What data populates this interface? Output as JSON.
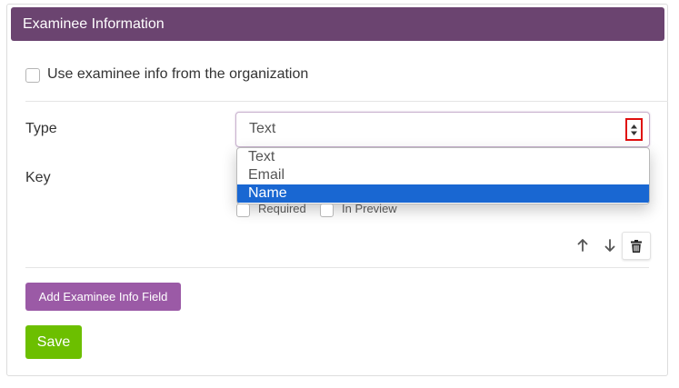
{
  "panel": {
    "title": "Examinee Information"
  },
  "use_org_info": {
    "label": "Use examinee info from the organization",
    "checked": false
  },
  "field": {
    "type_label": "Type",
    "key_label": "Key",
    "type_select": {
      "value": "Text",
      "options": [
        {
          "label": "Text",
          "highlighted": false
        },
        {
          "label": "Email",
          "highlighted": false
        },
        {
          "label": "Name",
          "highlighted": true
        }
      ]
    },
    "required_label": "Required",
    "in_preview_label": "In Preview",
    "icons": {
      "up": "arrow-up-icon",
      "down": "arrow-down-icon",
      "trash": "trash-icon",
      "select": "select-arrows-icon"
    }
  },
  "actions": {
    "add_field_label": "Add Examinee Info Field",
    "save_label": "Save"
  },
  "colors": {
    "header": "#6b4470",
    "add_button": "#9b5aa6",
    "save_button": "#6cbf00",
    "option_highlight": "#1967d2",
    "annotation_box": "#e01010"
  }
}
